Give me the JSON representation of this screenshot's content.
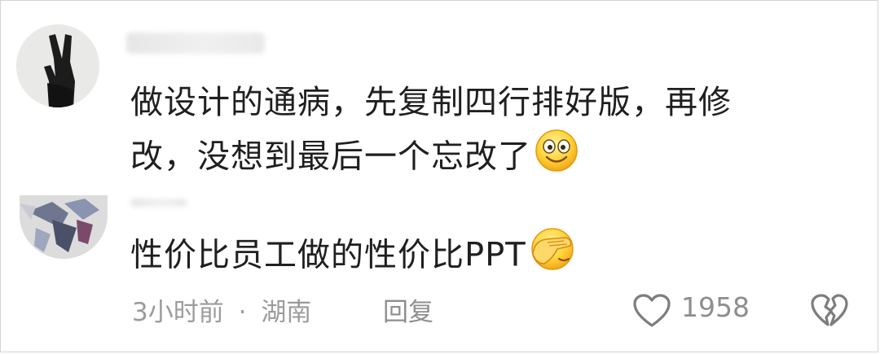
{
  "comments": [
    {
      "text_line1": "做设计的通病，先复制四行排好版，再修",
      "text_line2": "改，没想到最后一个忘改了",
      "emoji": "smile-emoji"
    },
    {
      "text": "性价比员工做的性价比PPT",
      "emoji": "facepalm-emoji"
    }
  ],
  "footer": {
    "time": "3小时前",
    "separator": "·",
    "location": "湖南",
    "reply_label": "回复",
    "like_count": "1958"
  },
  "icons": {
    "like": "heart-outline-icon",
    "dislike": "broken-heart-icon"
  },
  "colors": {
    "text": "#1f1f1f",
    "meta": "#9b9b9b",
    "emoji_yellow": "#ffd43b"
  }
}
